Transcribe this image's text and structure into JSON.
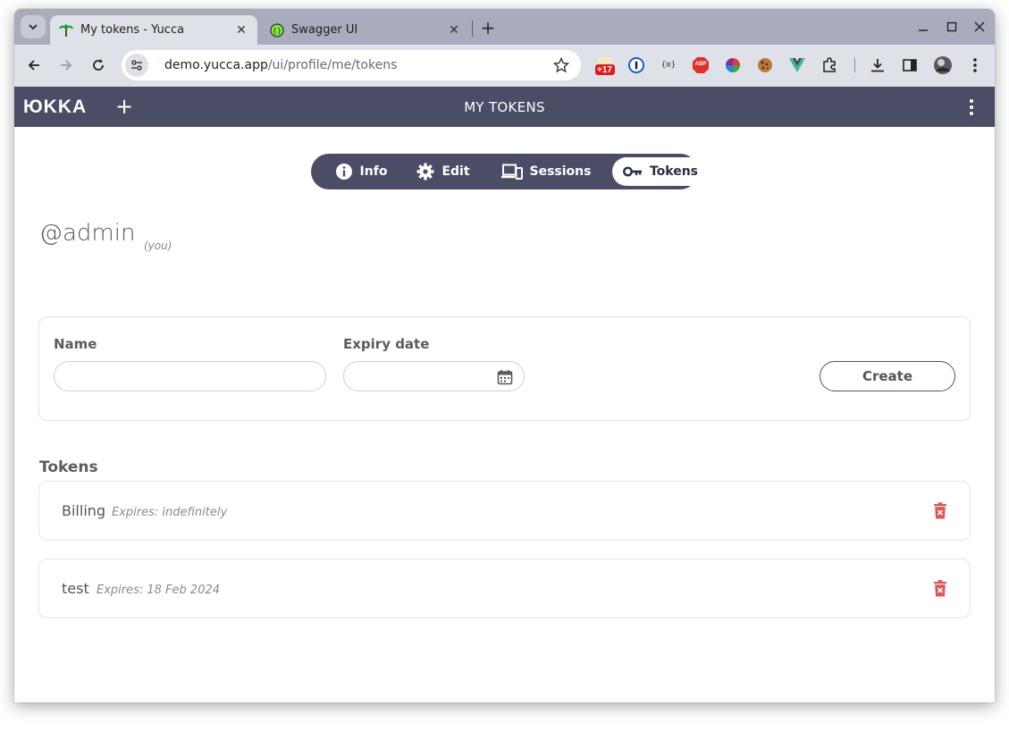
{
  "browser": {
    "tabs": [
      {
        "title": "My tokens - Yucca",
        "active": true
      },
      {
        "title": "Swagger UI",
        "active": false
      }
    ],
    "new_tab_label": "+",
    "url_host": "demo.yucca.app",
    "url_path": "/ui/profile/me/tokens",
    "extension_badge": "+17",
    "ext_json_label": "{≡}",
    "ext_abp_label": "ABP"
  },
  "app": {
    "logo": "ЮKKA",
    "plus_label": "+",
    "title": "MY TOKENS",
    "colors": {
      "bar": "#4b4d66",
      "danger": "#e05555"
    }
  },
  "profile_tabs": [
    {
      "label": "Info",
      "icon": "info-icon"
    },
    {
      "label": "Edit",
      "icon": "gear-icon"
    },
    {
      "label": "Sessions",
      "icon": "devices-icon"
    },
    {
      "label": "Tokens",
      "icon": "key-icon",
      "active": true
    }
  ],
  "user": {
    "handle": "@admin",
    "you_label": "(you)"
  },
  "form": {
    "name_label": "Name",
    "name_value": "",
    "expiry_label": "Expiry date",
    "expiry_value": "",
    "create_label": "Create"
  },
  "tokens_section": {
    "title": "Tokens",
    "items": [
      {
        "name": "Billing",
        "expires": "Expires: indefinitely"
      },
      {
        "name": "test",
        "expires": "Expires: 18 Feb 2024"
      }
    ]
  }
}
